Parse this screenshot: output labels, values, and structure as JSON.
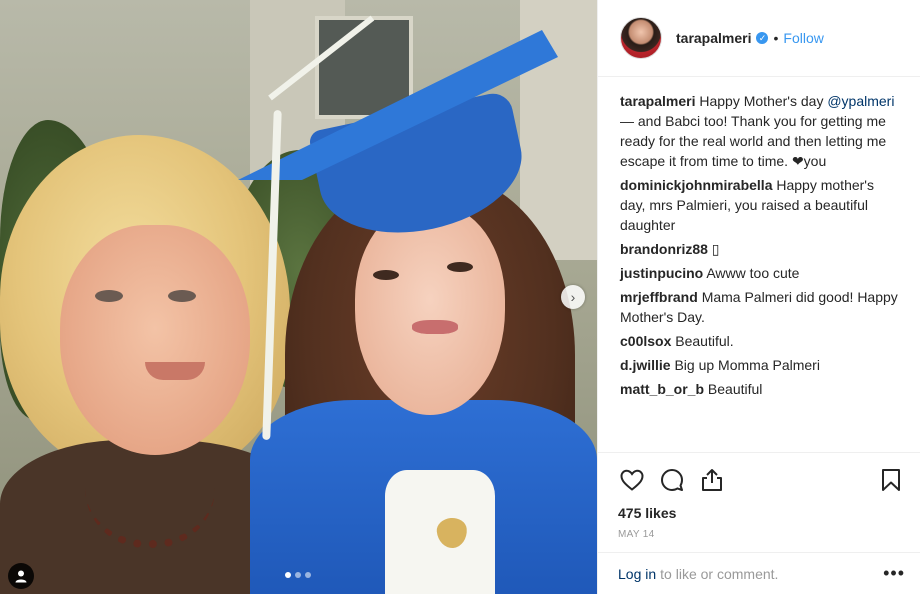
{
  "header": {
    "username": "tarapalmeri",
    "separator": "•",
    "follow_label": "Follow"
  },
  "comments": [
    {
      "user": "tarapalmeri",
      "pre": "Happy Mother's day ",
      "mention": "@ypalmeri",
      "post": " — and Babci too! Thank you for getting me ready for the real world and then letting me escape it from time to time. ❤you"
    },
    {
      "user": "dominickjohnmirabella",
      "text": "Happy mother's day, mrs Palmieri, you raised a beautiful daughter"
    },
    {
      "user": "brandonriz88",
      "text": "▯"
    },
    {
      "user": "justinpucino",
      "text": "Awww too cute"
    },
    {
      "user": "mrjeffbrand",
      "text": "Mama Palmeri did good! Happy Mother's Day."
    },
    {
      "user": "c00lsox",
      "text": "Beautiful."
    },
    {
      "user": "d.jwillie",
      "text": "Big up Momma Palmeri"
    },
    {
      "user": "matt_b_or_b",
      "text": "Beautiful"
    }
  ],
  "likes_text": "475 likes",
  "date_text": "MAY 14",
  "footer": {
    "login_label": "Log in",
    "login_rest": "to like or comment.",
    "more_label": "•••"
  },
  "carousel": {
    "slide_count": 3,
    "active_index": 0
  },
  "colors": {
    "link_blue": "#3897f0",
    "dark_link": "#003569",
    "text": "#262626",
    "muted": "#999999"
  }
}
